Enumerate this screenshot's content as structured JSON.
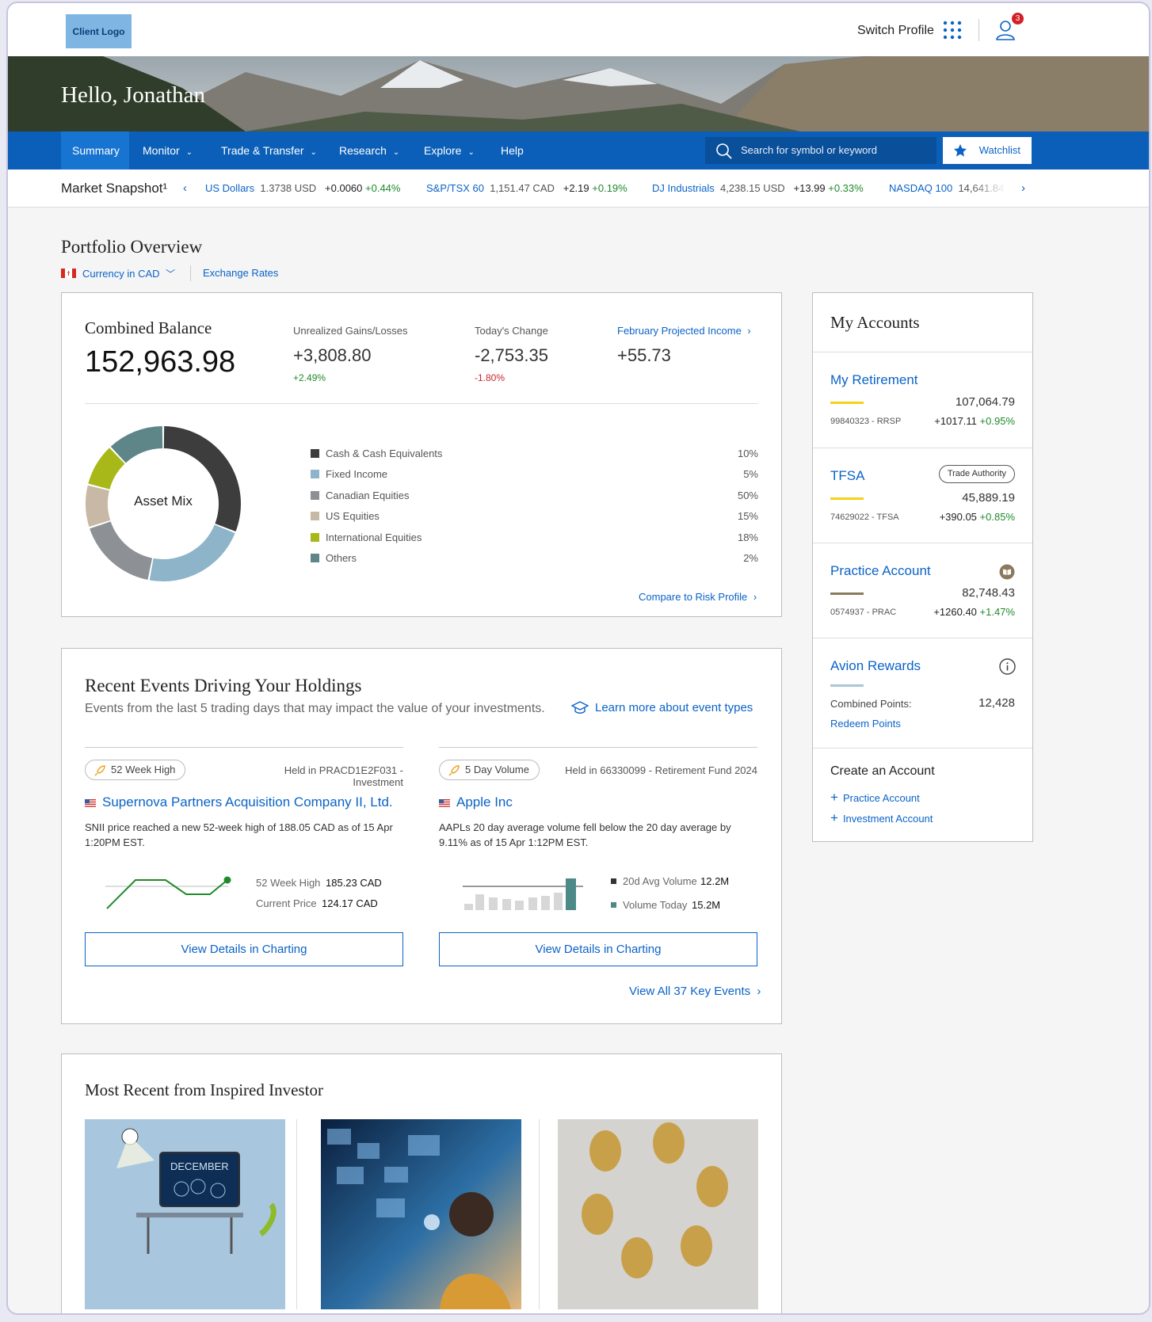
{
  "header": {
    "logo": "Client Logo",
    "switch_profile": "Switch Profile",
    "notification_count": "3",
    "greeting": "Hello, Jonathan"
  },
  "nav": {
    "items": [
      "Summary",
      "Monitor",
      "Trade & Transfer",
      "Research",
      "Explore",
      "Help"
    ],
    "search_placeholder": "Search for symbol or keyword",
    "watchlist": "Watchlist"
  },
  "snapshot": {
    "label": "Market Snapshot¹",
    "items": [
      {
        "name": "US Dollars",
        "value": "1.3738 USD",
        "change": "+0.0060",
        "pct": "+0.44%"
      },
      {
        "name": "S&P/TSX 60",
        "value": "1,151.47 CAD",
        "change": "+2.19",
        "pct": "+0.19%"
      },
      {
        "name": "DJ Industrials",
        "value": "4,238.15 USD",
        "change": "+13.99",
        "pct": "+0.33%"
      },
      {
        "name": "NASDAQ 100",
        "value": "14,641.84",
        "change": "",
        "pct": ""
      }
    ]
  },
  "overview": {
    "title": "Portfolio Overview",
    "currency": "Currency in CAD",
    "exchange": "Exchange Rates"
  },
  "balance": {
    "combined_label": "Combined Balance",
    "combined_value": "152,963.98",
    "unrealized_label": "Unrealized Gains/Losses",
    "unrealized_value": "+3,808.80",
    "unrealized_pct": "+2.49%",
    "today_label": "Today's Change",
    "today_value": "-2,753.35",
    "today_pct": "-1.80%",
    "income_label": "February Projected Income",
    "income_value": "+55.73"
  },
  "asset_mix": {
    "label": "Asset Mix",
    "compare": "Compare to Risk Profile",
    "items": [
      {
        "name": "Cash & Cash Equivalents",
        "pct": "10%",
        "color": "#3d3d3d"
      },
      {
        "name": "Fixed Income",
        "pct": "5%",
        "color": "#8db4c9"
      },
      {
        "name": "Canadian Equities",
        "pct": "50%",
        "color": "#8d9195"
      },
      {
        "name": "US Equities",
        "pct": "15%",
        "color": "#c7b9a6"
      },
      {
        "name": "International Equities",
        "pct": "18%",
        "color": "#a8b818"
      },
      {
        "name": "Others",
        "pct": "2%",
        "color": "#5e8587"
      }
    ]
  },
  "events": {
    "title": "Recent Events Driving Your Holdings",
    "subtitle": "Events from the last 5 trading days that may impact the value of your investments.",
    "learn": "Learn more about event types",
    "view_all": "View All 37 Key Events",
    "cards": [
      {
        "tag": "52 Week High",
        "held": "Held in PRACD1E2F031 - Investment",
        "company": "Supernova Partners Acquisition Company II, Ltd.",
        "desc": "SNII price reached a new 52-week high of 188.05 CAD as of 15 Apr 1:20PM EST.",
        "m1_label": "52 Week High",
        "m1_value": "185.23 CAD",
        "m2_label": "Current Price",
        "m2_value": "124.17 CAD",
        "button": "View Details in Charting"
      },
      {
        "tag": "5 Day Volume",
        "held": "Held in 66330099 - Retirement Fund 2024",
        "company": "Apple Inc",
        "desc": "AAPLs 20 day average volume fell below the 20 day average by 9.11% as of 15 Apr 1:12PM EST.",
        "m1_label": "20d Avg Volume",
        "m1_value": "12.2M",
        "m2_label": "Volume Today",
        "m2_value": "15.2M",
        "button": "View Details in Charting"
      }
    ]
  },
  "inspired": {
    "title": "Most Recent from Inspired Investor",
    "card1_text": "DECEMBER"
  },
  "accounts": {
    "title": "My Accounts",
    "items": [
      {
        "name": "My Retirement",
        "number": "99840323 - RRSP",
        "balance": "107,064.79",
        "change": "+1017.11",
        "pct": "+0.95%",
        "bar_color": "#f2d21b"
      },
      {
        "name": "TFSA",
        "badge": "Trade Authority",
        "number": "74629022 - TFSA",
        "balance": "45,889.19",
        "change": "+390.05",
        "pct": "+0.85%",
        "bar_color": "#f2d21b"
      },
      {
        "name": "Practice Account",
        "number": "0574937 - PRAC",
        "balance": "82,748.43",
        "change": "+1260.40",
        "pct": "+1.47%",
        "bar_color": "#8b7a5b"
      }
    ],
    "avion": {
      "name": "Avion Rewards",
      "points_label": "Combined Points:",
      "points": "12,428",
      "redeem": "Redeem Points"
    },
    "create": {
      "title": "Create an Account",
      "practice": "Practice Account",
      "investment": "Investment Account"
    }
  }
}
